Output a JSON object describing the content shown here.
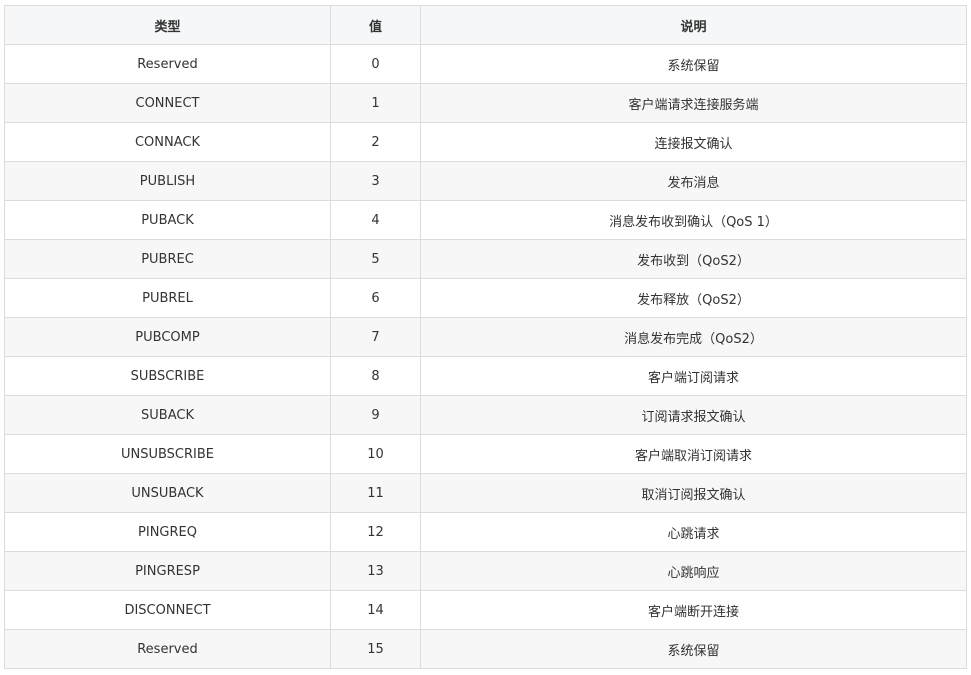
{
  "table": {
    "headers": [
      "类型",
      "值",
      "说明"
    ],
    "rows": [
      [
        "Reserved",
        "0",
        "系统保留"
      ],
      [
        "CONNECT",
        "1",
        "客户端请求连接服务端"
      ],
      [
        "CONNACK",
        "2",
        "连接报文确认"
      ],
      [
        "PUBLISH",
        "3",
        "发布消息"
      ],
      [
        "PUBACK",
        "4",
        "消息发布收到确认（QoS 1）"
      ],
      [
        "PUBREC",
        "5",
        "发布收到（QoS2）"
      ],
      [
        "PUBREL",
        "6",
        "发布释放（QoS2）"
      ],
      [
        "PUBCOMP",
        "7",
        "消息发布完成（QoS2）"
      ],
      [
        "SUBSCRIBE",
        "8",
        "客户端订阅请求"
      ],
      [
        "SUBACK",
        "9",
        "订阅请求报文确认"
      ],
      [
        "UNSUBSCRIBE",
        "10",
        "客户端取消订阅请求"
      ],
      [
        "UNSUBACK",
        "11",
        "取消订阅报文确认"
      ],
      [
        "PINGREQ",
        "12",
        "心跳请求"
      ],
      [
        "PINGRESP",
        "13",
        "心跳响应"
      ],
      [
        "DISCONNECT",
        "14",
        "客户端断开连接"
      ],
      [
        "Reserved",
        "15",
        "系统保留"
      ]
    ]
  }
}
